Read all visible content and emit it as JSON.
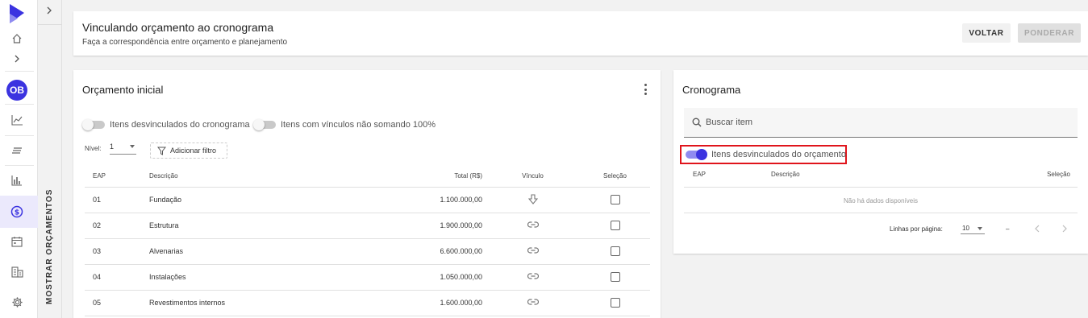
{
  "header": {
    "title": "Vinculando orçamento ao cronograma",
    "subtitle": "Faça a correspondência entre orçamento e planejamento",
    "back_label": "VOLTAR",
    "weigh_label": "PONDERAR"
  },
  "nav": {
    "avatar_initials": "OB",
    "side_panel_label": "MOSTRAR ORÇAMENTOS"
  },
  "orcamento": {
    "title": "Orçamento inicial",
    "toggle_unlinked": "Itens desvinculados do cronograma",
    "toggle_not_100": "Itens com vínculos não somando 100%",
    "level_label": "Nível:",
    "level_value": "1",
    "filter_label": "Adicionar filtro",
    "columns": {
      "eap": "EAP",
      "descricao": "Descrição",
      "total": "Total (R$)",
      "vinculo": "Vínculo",
      "selecao": "Seleção"
    },
    "rows": [
      {
        "eap": "01",
        "descricao": "Fundação",
        "total": "1.100.000,00",
        "vinculo_icon": "arrow-down-icon"
      },
      {
        "eap": "02",
        "descricao": "Estrutura",
        "total": "1.900.000,00",
        "vinculo_icon": "link-icon"
      },
      {
        "eap": "03",
        "descricao": "Alvenarias",
        "total": "6.600.000,00",
        "vinculo_icon": "link-icon"
      },
      {
        "eap": "04",
        "descricao": "Instalações",
        "total": "1.050.000,00",
        "vinculo_icon": "link-icon"
      },
      {
        "eap": "05",
        "descricao": "Revestimentos internos",
        "total": "1.600.000,00",
        "vinculo_icon": "link-icon"
      }
    ]
  },
  "cronograma": {
    "title": "Cronograma",
    "search_placeholder": "Buscar item",
    "toggle_unlinked": "Itens desvinculados do orçamento",
    "columns": {
      "eap": "EAP",
      "descricao": "Descrição",
      "selecao": "Seleção"
    },
    "empty_text": "Não há dados disponíveis",
    "rows_per_page_label": "Linhas por página:",
    "rows_per_page_value": "10",
    "range_text": "–"
  },
  "colors": {
    "accent": "#3b33e0",
    "highlight": "#e0141b"
  }
}
